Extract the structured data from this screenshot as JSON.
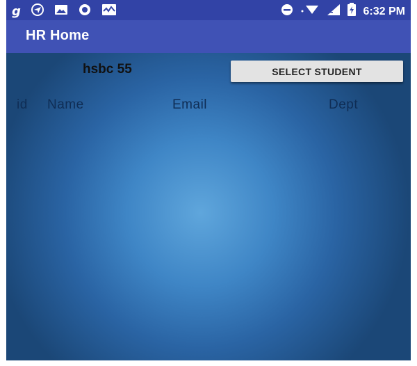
{
  "status_bar": {
    "icons_left": [
      "g-icon",
      "location-icon",
      "image-icon",
      "circle-icon",
      "activity-icon"
    ],
    "icons_right": [
      "minus-circle-icon",
      "wifi-icon",
      "signal-icon",
      "battery-icon"
    ],
    "g_glyph": "g",
    "time": "6:32 PM",
    "color": "#3243a6"
  },
  "app_bar": {
    "title": "HR Home",
    "color": "#4052b5"
  },
  "main": {
    "company_label": "hsbc 55",
    "select_button_label": "SELECT STUDENT",
    "table_headers": [
      "id",
      "Name",
      "Email",
      "Dept"
    ],
    "background_accent": "#3f86c6"
  }
}
